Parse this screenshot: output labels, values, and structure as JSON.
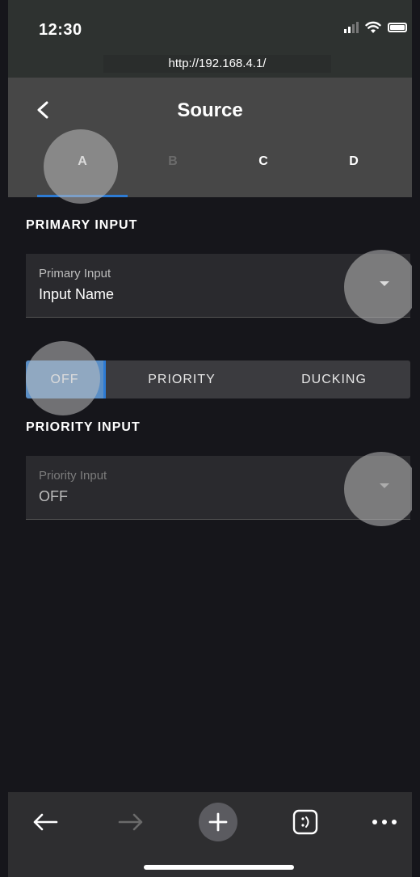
{
  "status_bar": {
    "time": "12:30"
  },
  "browser": {
    "url": "http://192.168.4.1/"
  },
  "header": {
    "title": "Source"
  },
  "tabs": [
    {
      "label": "A",
      "state": "active"
    },
    {
      "label": "B",
      "state": "disabled"
    },
    {
      "label": "C",
      "state": "normal"
    },
    {
      "label": "D",
      "state": "normal"
    }
  ],
  "primary": {
    "section_label": "PRIMARY INPUT",
    "field_label": "Primary Input",
    "value": "Input Name"
  },
  "mode": {
    "options": [
      "OFF",
      "PRIORITY",
      "DUCKING"
    ],
    "selected": "OFF"
  },
  "priority": {
    "section_label": "PRIORITY INPUT",
    "field_label": "Priority Input",
    "value": "OFF"
  },
  "colors": {
    "accent": "#2d7bd4",
    "header_bg": "#474747",
    "page_bg": "#16161b"
  },
  "icons": {
    "back": "chevron-left-icon",
    "toolbar": [
      "back-arrow-icon",
      "forward-arrow-icon",
      "plus-icon",
      "tabs-icon",
      "more-icon"
    ]
  }
}
